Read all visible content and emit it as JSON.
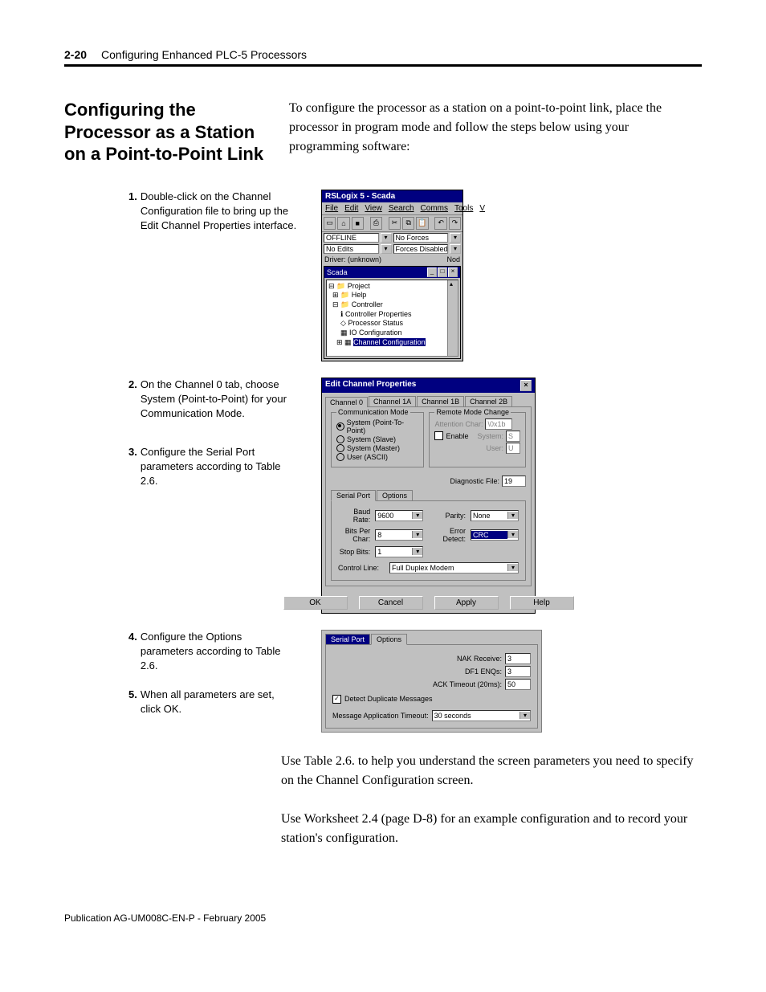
{
  "header": {
    "page_num": "2-20",
    "chapter": "Configuring Enhanced PLC-5 Processors"
  },
  "section_heading": "Configuring the Processor as a Station on a Point-to-Point Link",
  "intro": "To configure the processor as a station on a point-to-point link, place the processor in program mode and follow the steps below using your programming software:",
  "steps": {
    "s1": "Double-click on the Channel Configuration file to bring up the Edit Channel Properties interface.",
    "s2": "On the Channel 0 tab, choose System (Point-to-Point) for your Communication Mode.",
    "s3": "Configure the Serial Port parameters according to Table 2.6.",
    "s4": "Configure the Options parameters according to Table 2.6.",
    "s5": "When all parameters are set, click OK."
  },
  "win1": {
    "title": "RSLogix 5 - Scada",
    "menu": {
      "file": "File",
      "edit": "Edit",
      "view": "View",
      "search": "Search",
      "comms": "Comms",
      "tools": "Tools",
      "v": "V"
    },
    "status": {
      "offline": "OFFLINE",
      "noforces": "No Forces",
      "noedits": "No Edits",
      "forcesdis": "Forces Disabled"
    },
    "driver_lbl": "Driver: (unknown)",
    "nod": "Nod",
    "inner_title": "Scada",
    "tree": {
      "project": "Project",
      "help": "Help",
      "controller": "Controller",
      "ctrlprops": "Controller Properties",
      "procstatus": "Processor Status",
      "ioconfig": "IO Configuration",
      "chanconfig": "Channel Configuration"
    }
  },
  "dlg": {
    "title": "Edit Channel Properties",
    "tabs": {
      "c0": "Channel 0",
      "c1a": "Channel 1A",
      "c1b": "Channel 1B",
      "c2b": "Channel 2B"
    },
    "comm_mode": {
      "title": "Communication Mode",
      "r1": "System (Point-To-Point)",
      "r2": "System (Slave)",
      "r3": "System (Master)",
      "r4": "User (ASCII)"
    },
    "remote": {
      "title": "Remote Mode Change",
      "attn": "Attention Char:",
      "attn_val": "\\0x1b",
      "enable": "Enable",
      "system_lbl": "System:",
      "system_val": "S",
      "user_lbl": "User:",
      "user_val": "U"
    },
    "diag_lbl": "Diagnostic File:",
    "diag_val": "19",
    "subtabs": {
      "serial": "Serial Port",
      "options": "Options"
    },
    "serial": {
      "baud_lbl": "Baud Rate:",
      "baud_val": "9600",
      "parity_lbl": "Parity:",
      "parity_val": "None",
      "bits_lbl": "Bits Per Char:",
      "bits_val": "8",
      "err_lbl": "Error Detect:",
      "err_val": "CRC",
      "stop_lbl": "Stop Bits:",
      "stop_val": "1",
      "ctrl_lbl": "Control Line:",
      "ctrl_val": "Full Duplex Modem"
    },
    "buttons": {
      "ok": "OK",
      "cancel": "Cancel",
      "apply": "Apply",
      "help": "Help"
    }
  },
  "opts": {
    "subtabs": {
      "serial": "Serial Port",
      "options": "Options"
    },
    "nak_lbl": "NAK Receive:",
    "nak_val": "3",
    "enq_lbl": "DF1 ENQs:",
    "enq_val": "3",
    "ack_lbl": "ACK Timeout (20ms):",
    "ack_val": "50",
    "dup_lbl": "Detect Duplicate Messages",
    "msg_lbl": "Message Application Timeout:",
    "msg_val": "30 seconds"
  },
  "para1": "Use Table 2.6. to help you understand the screen parameters you need to specify on the Channel Configuration screen.",
  "para2": "Use Worksheet 2.4 (page D-8) for an example configuration and to record your station's configuration.",
  "publication": "Publication AG-UM008C-EN-P - February 2005"
}
